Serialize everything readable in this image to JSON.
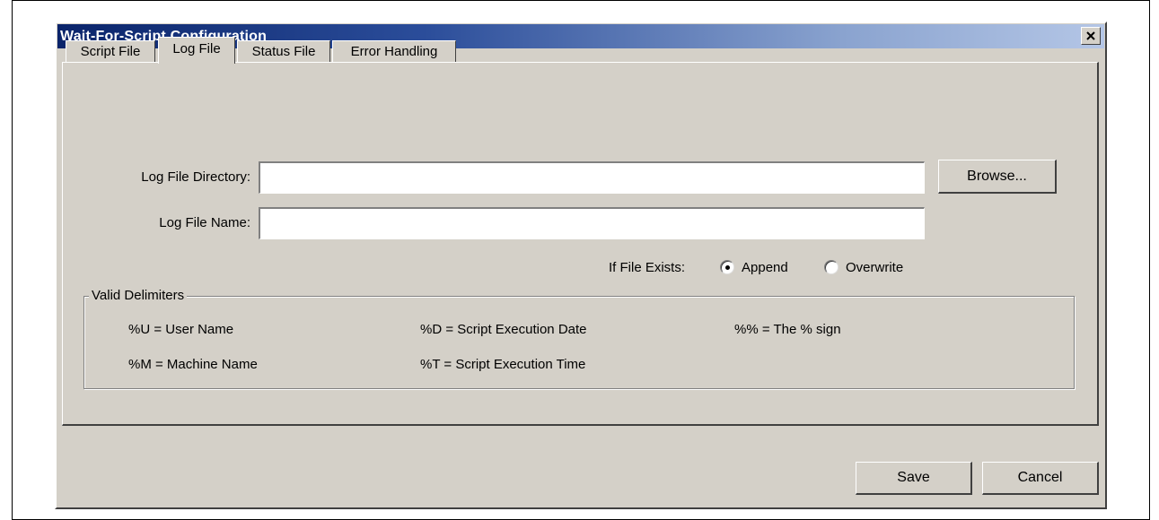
{
  "window": {
    "title": "Wait-For-Script Configuration",
    "close_glyph": "✕"
  },
  "tabs": [
    {
      "label": "Script File",
      "active": false
    },
    {
      "label": "Log File",
      "active": true
    },
    {
      "label": "Status File",
      "active": false
    },
    {
      "label": "Error Handling",
      "active": false
    }
  ],
  "log_file": {
    "directory_label": "Log File Directory:",
    "directory_value": "",
    "name_label": "Log File Name:",
    "name_value": "",
    "browse_label": "Browse...",
    "if_exists_label": "If File Exists:",
    "append_label": "Append",
    "overwrite_label": "Overwrite",
    "selected_option": "Append"
  },
  "delimiters": {
    "legend": "Valid Delimiters",
    "items": [
      "%U = User Name",
      "%D = Script Execution Date",
      "%% = The % sign",
      "%M = Machine Name",
      "%T = Script Execution Time"
    ]
  },
  "footer": {
    "save_label": "Save",
    "cancel_label": "Cancel"
  }
}
